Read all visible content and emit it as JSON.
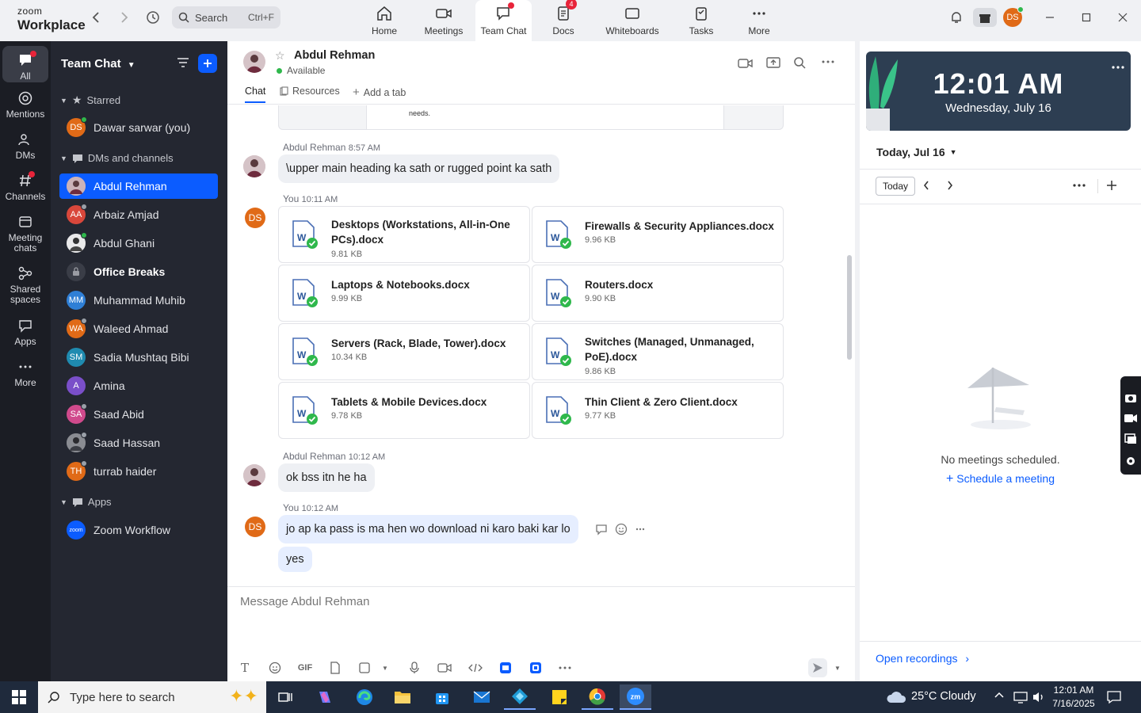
{
  "app": {
    "logo_line1": "zoom",
    "logo_line2": "Workplace"
  },
  "search": {
    "label": "Search",
    "shortcut": "Ctrl+F"
  },
  "nav": [
    {
      "label": "Home"
    },
    {
      "label": "Meetings"
    },
    {
      "label": "Team Chat"
    },
    {
      "label": "Docs",
      "badge": "4"
    },
    {
      "label": "Whiteboards"
    },
    {
      "label": "Tasks"
    },
    {
      "label": "More"
    }
  ],
  "user": {
    "initials": "DS"
  },
  "rail": [
    {
      "label": "All"
    },
    {
      "label": "Mentions"
    },
    {
      "label": "DMs"
    },
    {
      "label": "Channels"
    },
    {
      "label": "Meeting chats"
    },
    {
      "label": "Shared spaces"
    },
    {
      "label": "Apps"
    },
    {
      "label": "More"
    }
  ],
  "sidebar": {
    "title": "Team Chat",
    "starred_label": "Starred",
    "starred": [
      {
        "initials": "DS",
        "name": "Dawar sarwar (you)",
        "color": "#e06a17"
      }
    ],
    "dms_label": "DMs and channels",
    "dms": [
      {
        "initials": "",
        "name": "Abdul Rehman",
        "color": "#b48a94"
      },
      {
        "initials": "AA",
        "name": "Arbaiz Amjad",
        "color": "#d9473b"
      },
      {
        "initials": "",
        "name": "Abdul Ghani",
        "color": "#8a8f99"
      },
      {
        "initials": "",
        "name": "Office Breaks",
        "color": "#3a3d47"
      },
      {
        "initials": "MM",
        "name": "Muhammad Muhib",
        "color": "#2f7fd6"
      },
      {
        "initials": "WA",
        "name": "Waleed Ahmad",
        "color": "#e06a17"
      },
      {
        "initials": "SM",
        "name": "Sadia Mushtaq Bibi",
        "color": "#1f8bb0"
      },
      {
        "initials": "A",
        "name": "Amina",
        "color": "#7a4fc9"
      },
      {
        "initials": "SA",
        "name": "Saad Abid",
        "color": "#d04a8c"
      },
      {
        "initials": "",
        "name": "Saad Hassan",
        "color": "#6d6f77"
      },
      {
        "initials": "TH",
        "name": "turrab haider",
        "color": "#e06a17"
      }
    ],
    "apps_label": "Apps",
    "apps": [
      {
        "initials": "zoom",
        "name": "Zoom Workflow",
        "color": "#0b5cff"
      }
    ]
  },
  "chat": {
    "contact": "Abdul Rehman",
    "status": "Available",
    "tabs": [
      "Chat",
      "Resources",
      "Add a tab"
    ],
    "prev_fragment": "needs.",
    "msg1": {
      "sender": "Abdul Rehman",
      "time": "8:57 AM",
      "text": "\\upper main heading ka sath or rugged point ka sath"
    },
    "msg2": {
      "sender": "You",
      "time": "10:11 AM",
      "avatar": "DS"
    },
    "files": [
      {
        "name": "Desktops (Workstations, All-in-One PCs).docx",
        "size": "9.81 KB"
      },
      {
        "name": "Firewalls & Security Appliances.docx",
        "size": "9.96 KB"
      },
      {
        "name": "Laptops & Notebooks.docx",
        "size": "9.99 KB"
      },
      {
        "name": "Routers.docx",
        "size": "9.90 KB"
      },
      {
        "name": "Servers (Rack, Blade, Tower).docx",
        "size": "10.34 KB"
      },
      {
        "name": "Switches (Managed, Unmanaged, PoE).docx",
        "size": "9.86 KB"
      },
      {
        "name": "Tablets & Mobile Devices.docx",
        "size": "9.78 KB"
      },
      {
        "name": "Thin Client & Zero Client.docx",
        "size": "9.77 KB"
      }
    ],
    "msg3": {
      "sender": "Abdul Rehman",
      "time": "10:12 AM",
      "text": "ok bss itn  he ha"
    },
    "msg4": {
      "sender": "You",
      "time": "10:12 AM",
      "avatar": "DS",
      "text": "jo ap ka pass is ma hen wo download ni karo baki kar lo",
      "text2": "yes"
    },
    "composer_placeholder": "Message Abdul Rehman",
    "gif_label": "GIF"
  },
  "calendar": {
    "time": "12:01 AM",
    "date": "Wednesday, July 16",
    "day_select": "Today, Jul 16",
    "today_btn": "Today",
    "empty": "No meetings scheduled.",
    "schedule": "Schedule a meeting",
    "recordings": "Open recordings"
  },
  "taskbar": {
    "search_placeholder": "Type here to search",
    "weather": "25°C  Cloudy",
    "time": "12:01 AM",
    "date": "7/16/2025"
  }
}
